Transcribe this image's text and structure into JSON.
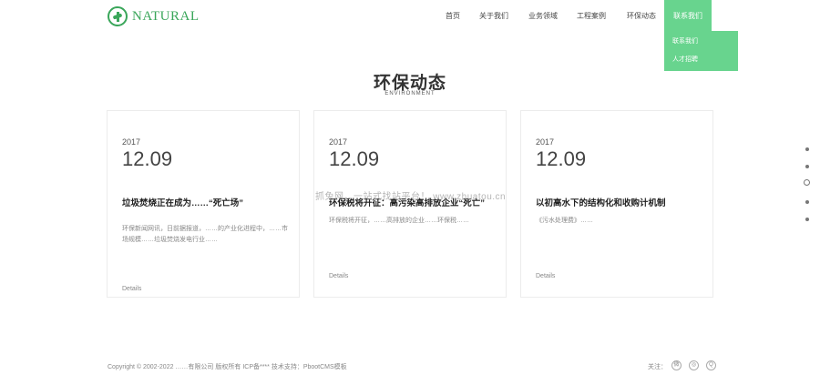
{
  "logo": {
    "text": "NATURAL",
    "icon": "leaf-logo-icon"
  },
  "nav": {
    "items": [
      {
        "label": "首页"
      },
      {
        "label": "关于我们"
      },
      {
        "label": "业务领域"
      },
      {
        "label": "工程案例"
      },
      {
        "label": "环保动态"
      }
    ],
    "active": {
      "label": "联系我们"
    },
    "dropdown": [
      {
        "label": "联系我们"
      },
      {
        "label": "人才招聘"
      }
    ],
    "accent_color": "#68d48e"
  },
  "section": {
    "title": "环保动态",
    "subtitle": "ENVIRONMENT"
  },
  "cards": [
    {
      "year": "2017",
      "date": "12.09",
      "title": "垃圾焚烧正在成为……“死亡场”",
      "desc": "环保新闻网讯，日前据报道，……的产业化进程中，……市场规模……垃圾焚烧发电行业……",
      "details": "Details"
    },
    {
      "year": "2017",
      "date": "12.09",
      "title": "环保税将开征：高污染高排放企业“死亡”",
      "desc": "环保税将开征，……高排放的企业……环保税……",
      "details": "Details"
    },
    {
      "year": "2017",
      "date": "12.09",
      "title": "以初高水下的结构化和收购计机制",
      "desc": "《污水处理费》……",
      "details": "Details"
    }
  ],
  "watermark": "抓兔网，一站式找站平台！ www.zhuatou.cn",
  "side_nav": {
    "count": 5,
    "active_index": 2
  },
  "footer": {
    "copyright": "Copyright © 2002-2022 ……有限公司 版权所有 ICP备**** 技术支持：PbootCMS模板",
    "follow_label": "关注：",
    "social": [
      {
        "icon": "weibo-icon",
        "glyph": "微"
      },
      {
        "icon": "wechat-icon",
        "glyph": "◎"
      },
      {
        "icon": "qq-icon",
        "glyph": "Q"
      }
    ]
  }
}
